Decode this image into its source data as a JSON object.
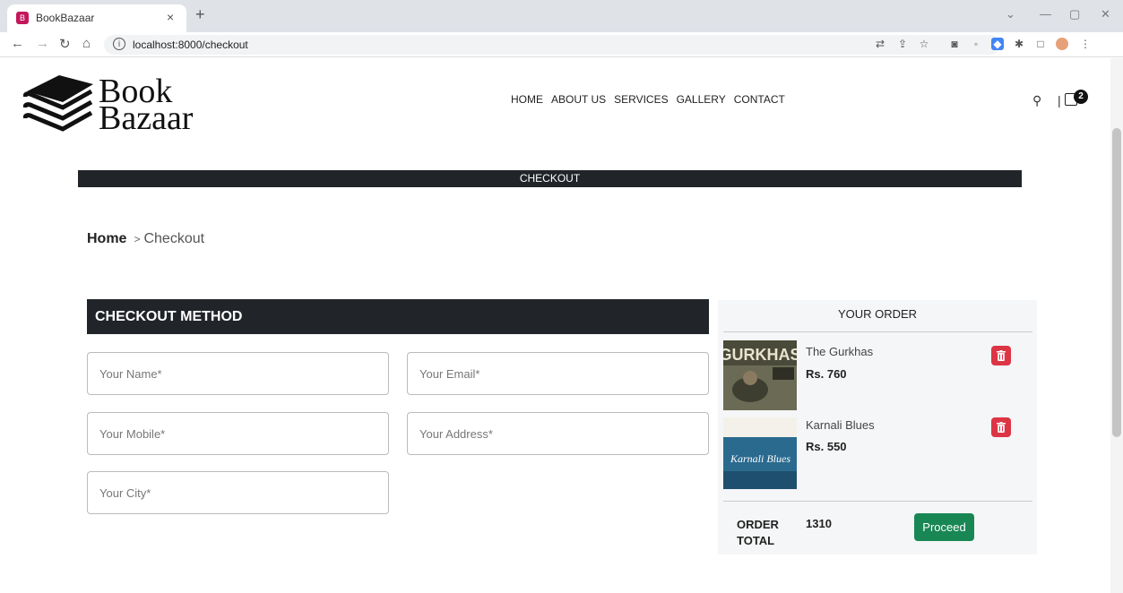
{
  "browser": {
    "tab_title": "BookBazaar",
    "tab_close": "×",
    "new_tab": "+",
    "url": "localhost:8000/checkout",
    "controls": {
      "minimize": "—",
      "restore": "▢",
      "close": "✕",
      "dropdown": "⌄"
    }
  },
  "header": {
    "logo": {
      "line1": "Book",
      "line2": "Bazaar"
    },
    "nav": [
      "HOME",
      "ABOUT US",
      "SERVICES",
      "GALLERY",
      "CONTACT"
    ],
    "cart_count": "2"
  },
  "banner": {
    "title": "CHECKOUT"
  },
  "breadcrumb": {
    "home": "Home",
    "separator": ">",
    "current": "Checkout"
  },
  "checkout_form": {
    "title": "CHECKOUT METHOD",
    "fields": {
      "name": "Your Name*",
      "email": "Your Email*",
      "mobile": "Your Mobile*",
      "address": "Your Address*",
      "city": "Your City*"
    }
  },
  "order": {
    "title": "YOUR ORDER",
    "items": [
      {
        "title": "The Gurkhas",
        "price": "Rs. 760",
        "cover_text": "GURKHAS"
      },
      {
        "title": "Karnali Blues",
        "price": "Rs. 550",
        "cover_text": "Karnali Blues"
      }
    ],
    "total_label": "ORDER TOTAL",
    "total_value": "1310",
    "proceed_label": "Proceed"
  },
  "colors": {
    "dark": "#212529",
    "delete": "#dc3545",
    "proceed": "#198754",
    "panel": "#f5f6f7"
  }
}
